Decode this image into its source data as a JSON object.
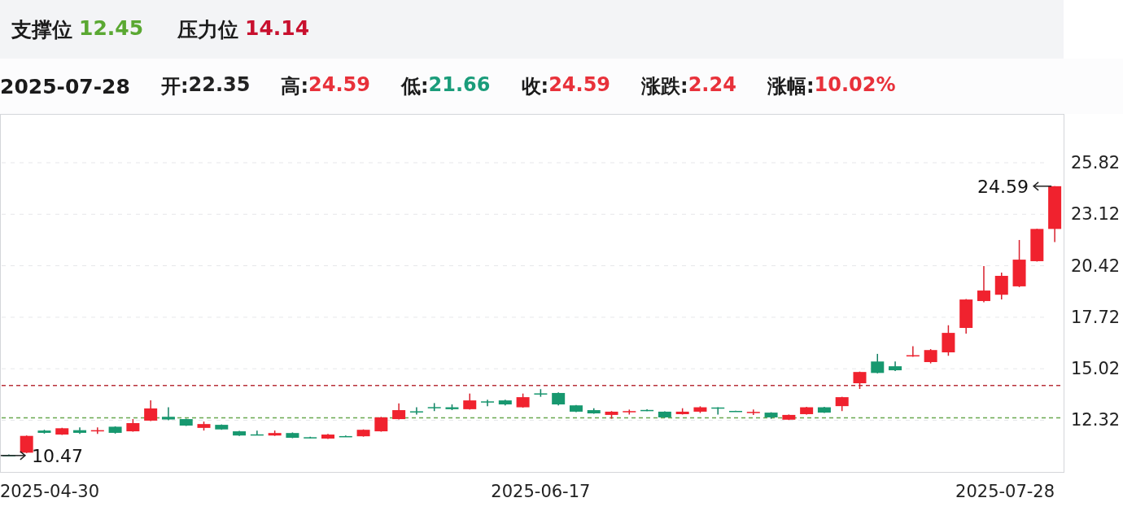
{
  "levels": [
    {
      "label": "支撑位",
      "value": "12.45",
      "color": "#5aa832"
    },
    {
      "label": "压力位",
      "value": "14.14",
      "color": "#c8102e"
    }
  ],
  "quote": {
    "date": "2025-07-28",
    "fields": [
      {
        "label": "开:",
        "value": "22.35",
        "color": "#222222"
      },
      {
        "label": "高:",
        "value": "24.59",
        "color": "#e8313a"
      },
      {
        "label": "低:",
        "value": "21.66",
        "color": "#1a9c7a"
      },
      {
        "label": "收:",
        "value": "24.59",
        "color": "#e8313a"
      },
      {
        "label": "涨跌:",
        "value": "2.24",
        "color": "#e8313a"
      },
      {
        "label": "涨幅:",
        "value": "10.02%",
        "color": "#e8313a"
      }
    ]
  },
  "chart": {
    "chart_data": {
      "type": "candlestick",
      "categories": [
        null,
        null,
        null,
        null,
        null,
        null,
        null,
        null,
        null,
        null,
        null,
        null,
        null,
        null,
        null,
        null,
        null,
        null,
        null,
        null,
        null,
        null,
        null,
        null,
        null,
        null,
        null,
        null,
        null,
        null,
        null,
        null,
        null,
        null,
        null,
        null,
        null,
        null,
        null,
        null,
        null,
        null,
        null,
        null,
        null,
        null,
        null,
        null,
        null,
        null,
        null,
        null,
        null,
        null,
        null,
        null,
        null,
        null,
        null,
        null
      ],
      "ylim": [
        9.61,
        28.38
      ],
      "yticks": [
        12.32,
        15.02,
        17.72,
        20.42,
        23.12,
        25.82
      ],
      "grid": true,
      "ohlc": [
        [
          10.5,
          10.53,
          10.47,
          10.48
        ],
        [
          10.62,
          11.52,
          10.6,
          11.5
        ],
        [
          11.78,
          11.82,
          11.62,
          11.66
        ],
        [
          11.57,
          11.92,
          11.55,
          11.9
        ],
        [
          11.8,
          11.95,
          11.6,
          11.66
        ],
        [
          11.78,
          11.95,
          11.6,
          11.8
        ],
        [
          11.98,
          12.0,
          11.62,
          11.66
        ],
        [
          11.74,
          12.38,
          11.72,
          12.17
        ],
        [
          12.3,
          13.36,
          12.28,
          12.94
        ],
        [
          12.5,
          13.0,
          12.32,
          12.36
        ],
        [
          12.38,
          12.4,
          12.02,
          12.04
        ],
        [
          11.92,
          12.25,
          11.78,
          12.12
        ],
        [
          12.08,
          12.1,
          11.82,
          11.84
        ],
        [
          11.74,
          11.76,
          11.5,
          11.52
        ],
        [
          11.58,
          11.78,
          11.55,
          11.56
        ],
        [
          11.52,
          11.78,
          11.5,
          11.65
        ],
        [
          11.65,
          11.68,
          11.38,
          11.4
        ],
        [
          11.43,
          11.45,
          11.38,
          11.41
        ],
        [
          11.36,
          11.6,
          11.34,
          11.57
        ],
        [
          11.49,
          11.52,
          11.45,
          11.47
        ],
        [
          11.48,
          11.84,
          11.46,
          11.82
        ],
        [
          11.74,
          12.5,
          11.72,
          12.47
        ],
        [
          12.38,
          13.2,
          12.36,
          12.85
        ],
        [
          12.79,
          13.0,
          12.62,
          12.76
        ],
        [
          13.01,
          13.22,
          12.8,
          12.99
        ],
        [
          13.0,
          13.15,
          12.85,
          12.9
        ],
        [
          12.9,
          13.72,
          12.88,
          13.36
        ],
        [
          13.31,
          13.4,
          13.05,
          13.29
        ],
        [
          13.36,
          13.4,
          13.1,
          13.15
        ],
        [
          13.0,
          13.72,
          12.98,
          13.53
        ],
        [
          13.73,
          13.95,
          13.55,
          13.71
        ],
        [
          13.75,
          13.78,
          13.1,
          13.15
        ],
        [
          13.1,
          13.12,
          12.75,
          12.77
        ],
        [
          12.85,
          12.95,
          12.66,
          12.68
        ],
        [
          12.6,
          12.8,
          12.4,
          12.77
        ],
        [
          12.78,
          12.88,
          12.62,
          12.8
        ],
        [
          12.86,
          12.9,
          12.8,
          12.84
        ],
        [
          12.77,
          12.79,
          12.45,
          12.47
        ],
        [
          12.64,
          12.95,
          12.62,
          12.77
        ],
        [
          12.77,
          13.05,
          12.7,
          13.0
        ],
        [
          12.99,
          13.0,
          12.62,
          12.97
        ],
        [
          12.81,
          12.82,
          12.78,
          12.79
        ],
        [
          12.74,
          12.88,
          12.6,
          12.76
        ],
        [
          12.72,
          12.74,
          12.4,
          12.47
        ],
        [
          12.35,
          12.62,
          12.33,
          12.6
        ],
        [
          12.64,
          13.02,
          12.62,
          13.0
        ],
        [
          13.0,
          13.02,
          12.7,
          12.72
        ],
        [
          13.06,
          13.55,
          12.8,
          13.53
        ],
        [
          14.26,
          14.87,
          13.96,
          14.85
        ],
        [
          15.4,
          15.8,
          14.78,
          14.8
        ],
        [
          15.15,
          15.4,
          14.9,
          14.94
        ],
        [
          15.7,
          16.2,
          15.65,
          15.73
        ],
        [
          15.37,
          16.05,
          15.3,
          16.0
        ],
        [
          15.88,
          17.3,
          15.7,
          16.9
        ],
        [
          17.16,
          18.68,
          16.86,
          18.65
        ],
        [
          18.57,
          20.4,
          18.5,
          19.12
        ],
        [
          18.9,
          20.06,
          18.65,
          19.89
        ],
        [
          19.34,
          21.77,
          19.3,
          20.74
        ],
        [
          20.66,
          22.36,
          20.64,
          22.35
        ],
        [
          22.35,
          24.59,
          21.66,
          24.59
        ]
      ],
      "ref_lines": [
        {
          "axis": "y",
          "value": 14.14,
          "color": "#b8323a"
        },
        {
          "axis": "y",
          "value": 12.45,
          "color": "#6aa84f"
        }
      ],
      "annotations": [
        "10.47",
        "24.59"
      ]
    },
    "date_labels": [
      "2025-04-30",
      "2025-06-17",
      "2025-07-28"
    ]
  }
}
